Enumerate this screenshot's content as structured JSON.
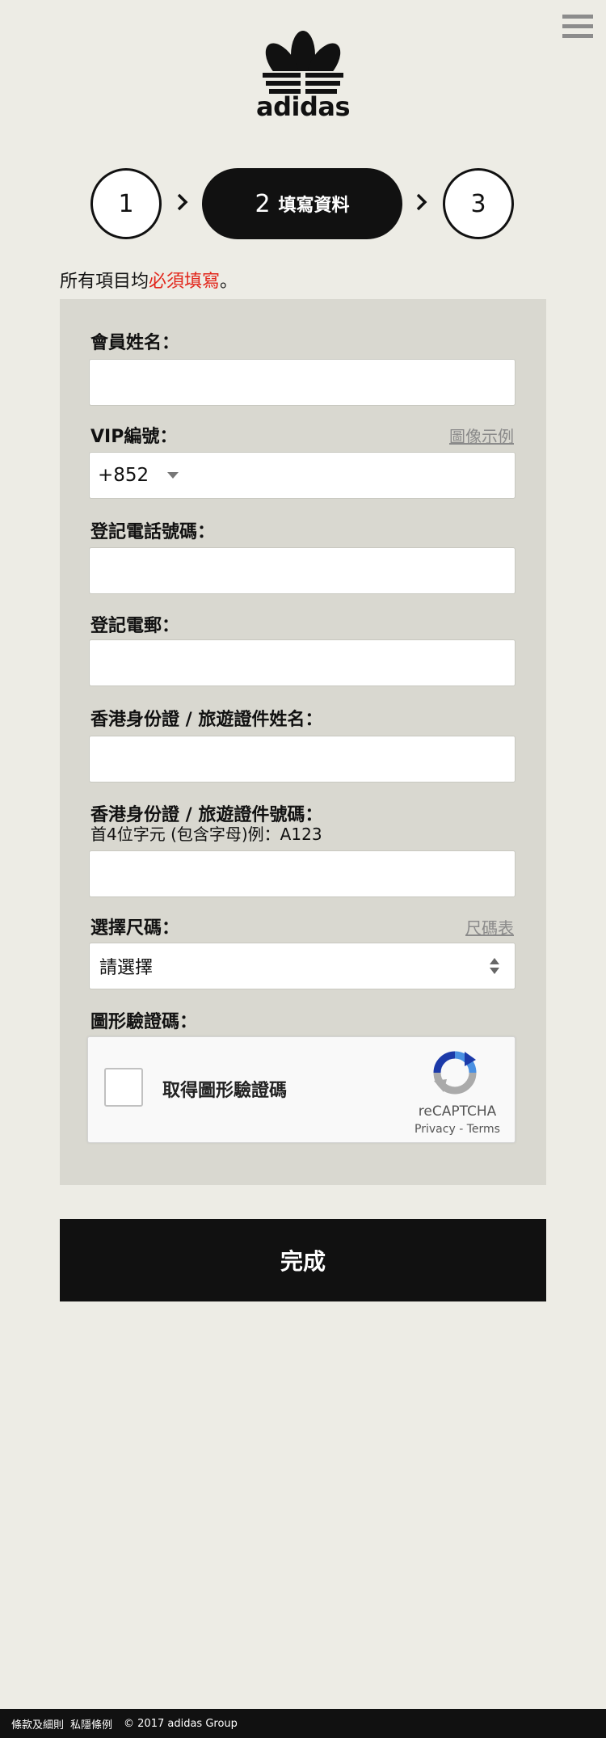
{
  "header": {
    "brand": "adidas",
    "menu_icon": "hamburger-menu-icon"
  },
  "stepper": {
    "step1": "1",
    "step2_num": "2",
    "step2_label": "填寫資料",
    "step3": "3"
  },
  "notice": {
    "prefix": "所有項目均",
    "required": "必須填寫",
    "suffix": "。",
    "required_color": "#e2261b"
  },
  "form": {
    "name_label": "會員姓名：",
    "vip_label": "VIP編號：",
    "vip_example_link": "圖像示例",
    "vip_prefix": "+852",
    "phone_label": "登記電話號碼：",
    "email_label": "登記電郵：",
    "id_name_label": "香港身份證 / 旅遊證件姓名：",
    "id_number_label": "香港身份證 / 旅遊證件號碼：",
    "id_number_hint": "首4位字元 (包含字母)例：A123",
    "size_label": "選擇尺碼：",
    "size_chart_link": "尺碼表",
    "size_select_value": "請選擇",
    "captcha_label": "圖形驗證碼："
  },
  "captcha": {
    "checkbox_label": "取得圖形驗證碼",
    "brand": "reCAPTCHA",
    "privacy": "Privacy",
    "separator": " - ",
    "terms": "Terms"
  },
  "submit": {
    "label": "完成"
  },
  "footer": {
    "terms": "條款及細則",
    "privacy": "私隱條例",
    "copyright": "© 2017 adidas Group"
  }
}
